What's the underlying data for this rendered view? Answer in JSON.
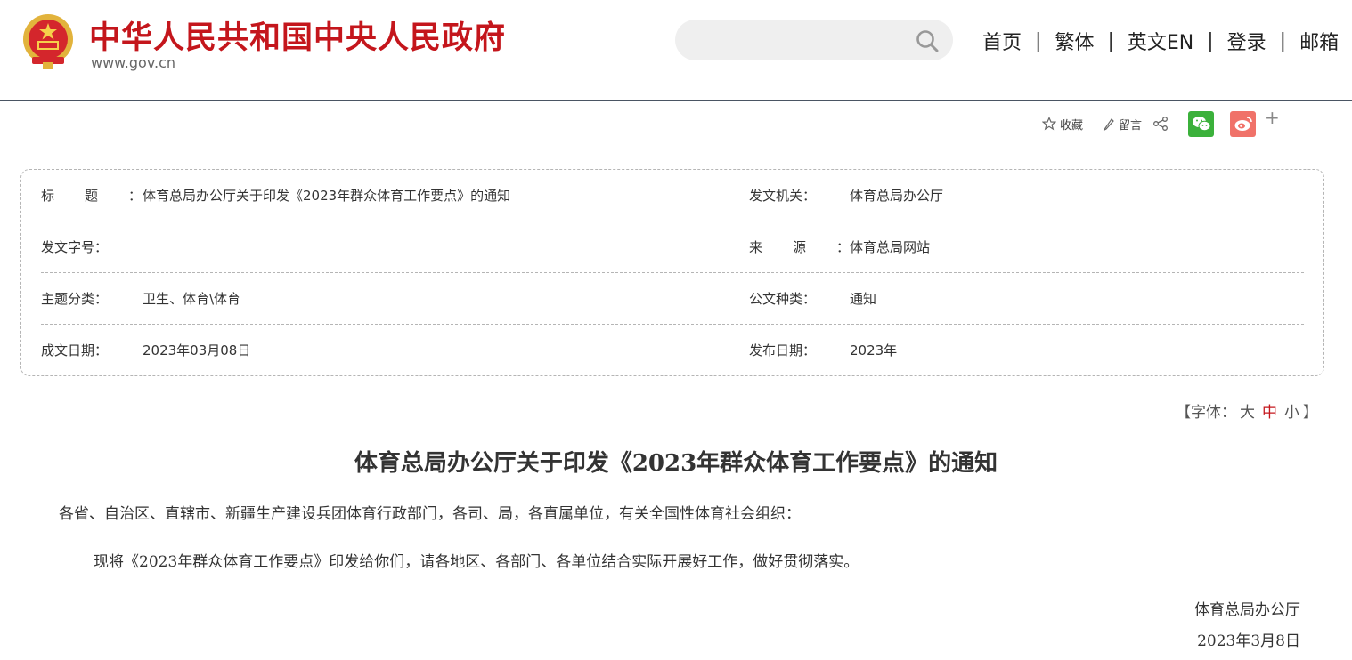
{
  "header": {
    "site_name": "中华人民共和国中央人民政府",
    "site_url": "www.gov.cn",
    "search_placeholder": "",
    "nav": [
      {
        "label": "首页"
      },
      {
        "label": "繁体"
      },
      {
        "label": "英文EN"
      },
      {
        "label": "登录"
      },
      {
        "label": "邮箱"
      }
    ],
    "nav_separator": "|",
    "brand_color": "#c4161c"
  },
  "toolbar": {
    "favorite_label": "收藏",
    "comment_label": "留言",
    "plus_label": "+",
    "icons": [
      "star-icon",
      "pencil-icon",
      "share-icon",
      "wechat-icon",
      "weibo-icon",
      "plus-icon"
    ]
  },
  "info": {
    "rows": [
      {
        "label1": "标题：",
        "value1": "体育总局办公厅关于印发《2023年群众体育工作要点》的通知",
        "label2": "发文机关：",
        "value2": "体育总局办公厅"
      },
      {
        "label1": "发文字号：",
        "value1": "",
        "label2": "来源：",
        "value2": "体育总局网站"
      },
      {
        "label1": "主题分类：",
        "value1": "卫生、体育\\体育",
        "label2": "公文种类：",
        "value2": "通知"
      },
      {
        "label1": "成文日期：",
        "value1": "2023年03月08日",
        "label2": "发布日期：",
        "value2": "2023年"
      }
    ]
  },
  "font_control": {
    "open": "【字体：",
    "large": "大",
    "medium": "中",
    "small": "小",
    "close": "】",
    "selected": "中"
  },
  "article": {
    "title": "体育总局办公厅关于印发《2023年群众体育工作要点》的通知",
    "salutation": "各省、自治区、直辖市、新疆生产建设兵团体育行政部门，各司、局，各直属单位，有关全国性体育社会组织：",
    "body": "现将《2023年群众体育工作要点》印发给你们，请各地区、各部门、各单位结合实际开展好工作，做好贯彻落实。",
    "signature_org": "体育总局办公厅",
    "signature_date": "2023年3月8日"
  }
}
